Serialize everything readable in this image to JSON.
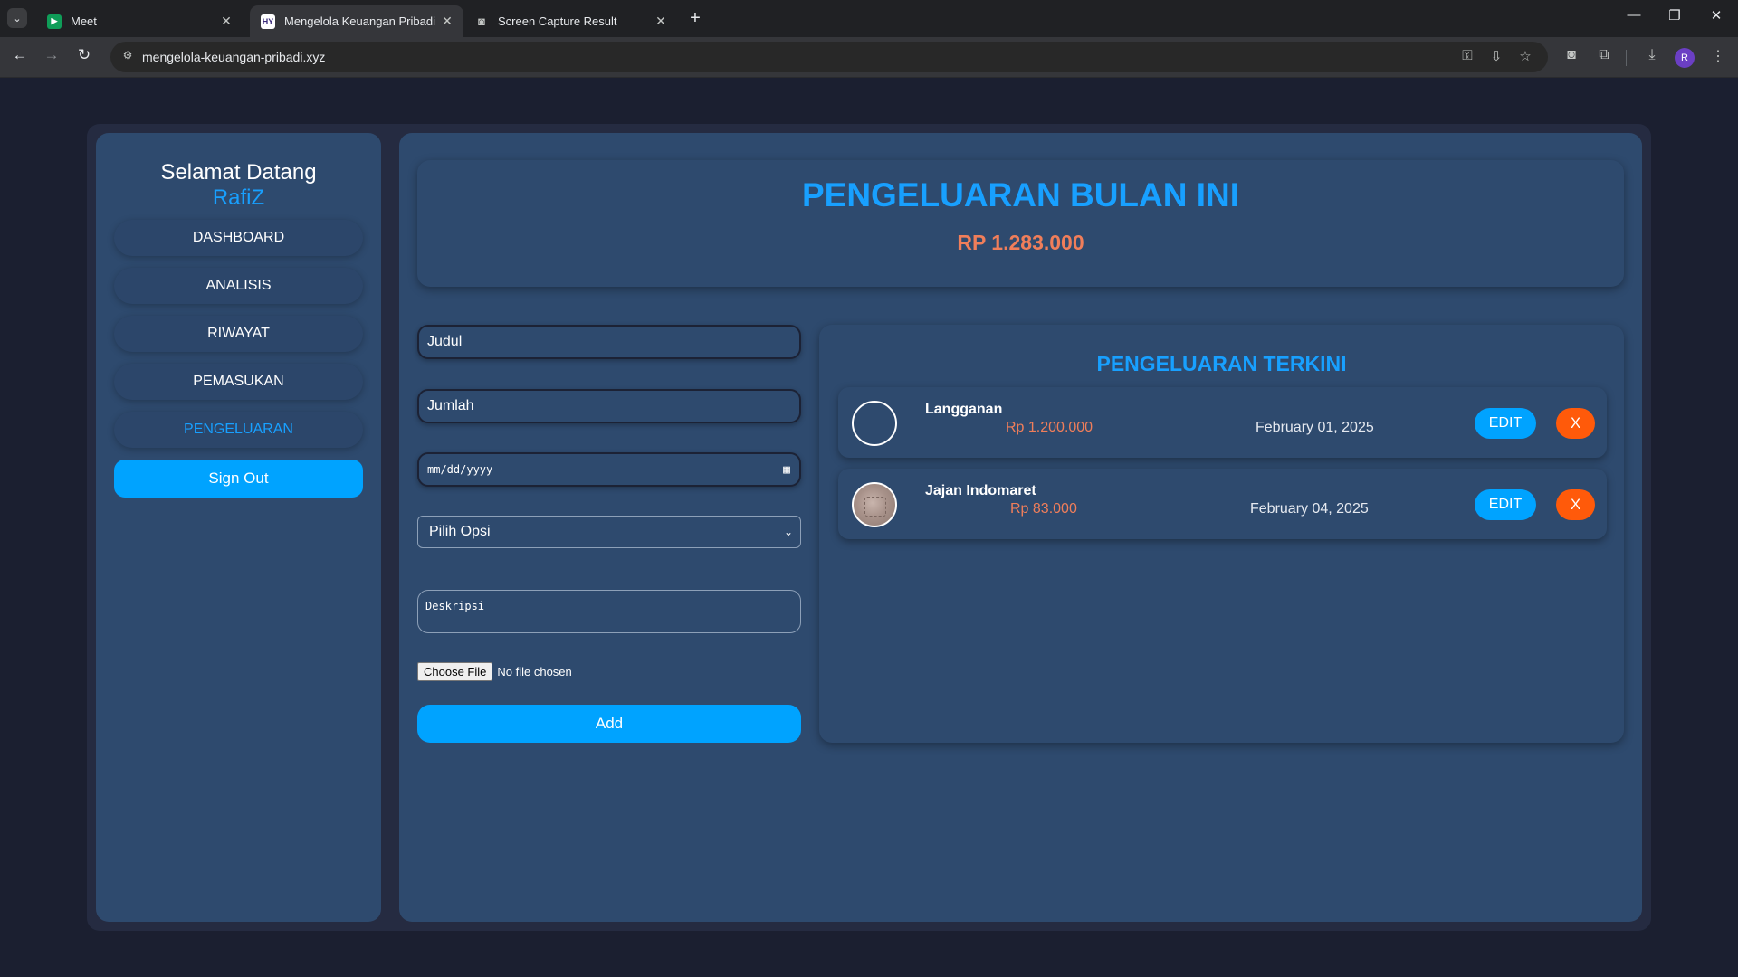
{
  "browser": {
    "tabs": [
      {
        "title": "Meet",
        "icon": "meet-icon",
        "close": "✕"
      },
      {
        "title": "Mengelola Keuangan Pribadi",
        "icon": "site-logo-icon",
        "icon_text": "HY",
        "close": "✕"
      },
      {
        "title": "Screen Capture Result",
        "icon": "camera-icon",
        "close": "✕"
      }
    ],
    "url": "mengelola-keuangan-pribadi.xyz",
    "profile_initial": "R"
  },
  "sidebar": {
    "welcome": "Selamat Datang",
    "username": "RafiZ",
    "nav": [
      {
        "label": "DASHBOARD",
        "active": false
      },
      {
        "label": "ANALISIS",
        "active": false
      },
      {
        "label": "RIWAYAT",
        "active": false
      },
      {
        "label": "PEMASUKAN",
        "active": false
      },
      {
        "label": "PENGELUARAN",
        "active": true
      }
    ],
    "signout_label": "Sign Out"
  },
  "summary": {
    "title": "PENGELUARAN BULAN INI",
    "amount": "RP 1.283.000"
  },
  "form": {
    "title_placeholder": "Judul",
    "amount_placeholder": "Jumlah",
    "date_placeholder": "mm/dd/yyyy",
    "select_value": "Pilih Opsi",
    "description_placeholder": "Deskripsi",
    "file_button": "Choose File",
    "file_status": "No file chosen",
    "add_label": "Add"
  },
  "recent": {
    "title": "PENGELUARAN TERKINI",
    "items": [
      {
        "name": "Langganan",
        "amount": "Rp 1.200.000",
        "date": "February 01, 2025",
        "edit_label": "EDIT",
        "delete_label": "X"
      },
      {
        "name": "Jajan Indomaret",
        "amount": "Rp 83.000",
        "date": "February 04, 2025",
        "edit_label": "EDIT",
        "delete_label": "X"
      }
    ]
  },
  "colors": {
    "accent": "#00a3ff",
    "highlight_text": "#18a0ff",
    "amount": "#f07e5a",
    "danger": "#ff5a0a",
    "panel": "#2e4a6e",
    "background": "#1b1f30"
  }
}
